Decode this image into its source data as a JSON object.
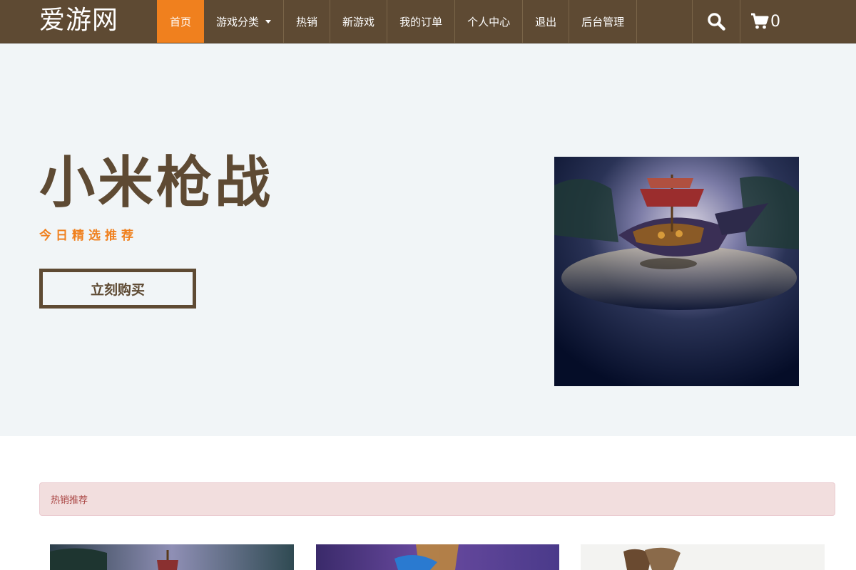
{
  "brand": "爱游网",
  "nav": {
    "items": [
      {
        "label": "首页",
        "active": true
      },
      {
        "label": "游戏分类",
        "dropdown": true
      },
      {
        "label": "热销"
      },
      {
        "label": "新游戏"
      },
      {
        "label": "我的订单"
      },
      {
        "label": "个人中心"
      },
      {
        "label": "退出"
      },
      {
        "label": "后台管理"
      }
    ],
    "search_icon": "search-icon",
    "cart_icon": "cart-icon",
    "cart_count": "0"
  },
  "hero": {
    "title": "小米枪战",
    "subtitle": "今日精选推荐",
    "buy_label": "立刻购买"
  },
  "section": {
    "alert_text": "热销推荐"
  },
  "colors": {
    "navbar": "#5e4a33",
    "accent": "#f0801e",
    "hero_bg": "#f1f5f7",
    "alert_bg": "#f2dede",
    "alert_text": "#a94442"
  }
}
